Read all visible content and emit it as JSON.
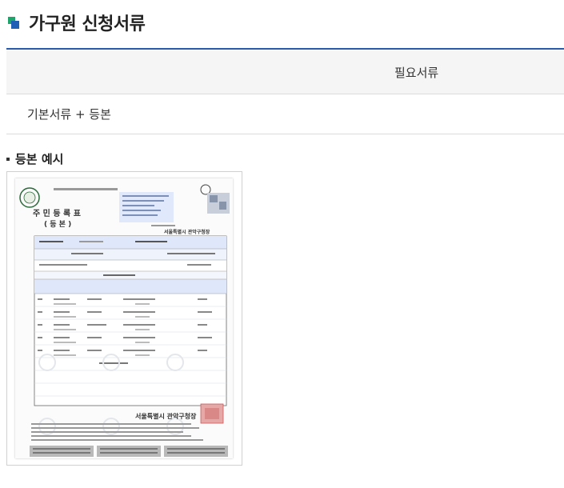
{
  "page": {
    "title": "가구원 신청서류"
  },
  "table": {
    "header": "필요서류",
    "rows": [
      "기본서류 + 등본"
    ]
  },
  "example": {
    "heading": "등본 예시",
    "document": {
      "title": "주 민 등 록 표",
      "subtitle": "( 등  본 )",
      "issuer": "서울특별시 관악구청장"
    }
  },
  "icons": {
    "title": "title-square-icon",
    "bullet": "bullet-icon"
  }
}
